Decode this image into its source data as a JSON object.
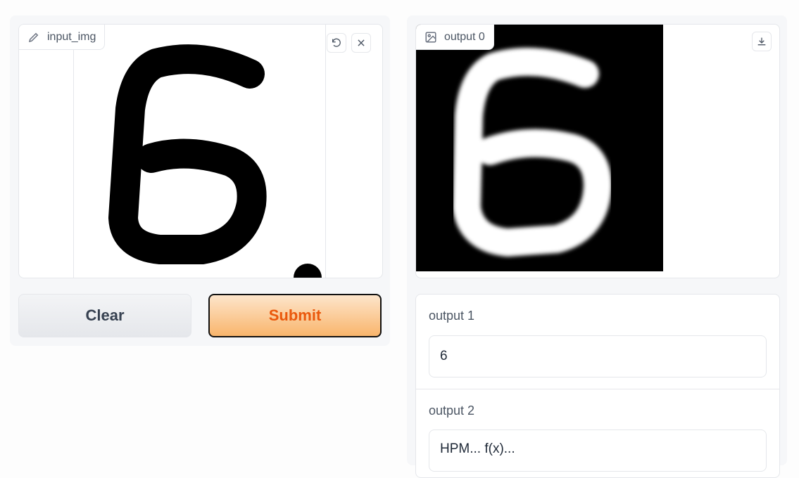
{
  "input_panel": {
    "label": "input_img",
    "label_icon": "pencil-icon",
    "undo_icon": "undo-icon",
    "close_icon": "close-icon",
    "clear_label": "Clear",
    "submit_label": "Submit"
  },
  "outputs": {
    "output0": {
      "label": "output 0",
      "label_icon": "image-icon",
      "download_icon": "download-icon"
    },
    "output1": {
      "label": "output 1",
      "value": "6"
    },
    "output2": {
      "label": "output 2",
      "value": "HPM... f(x)..."
    }
  },
  "colors": {
    "submit_text": "#ea580c",
    "submit_bg": "#f9b56c"
  }
}
